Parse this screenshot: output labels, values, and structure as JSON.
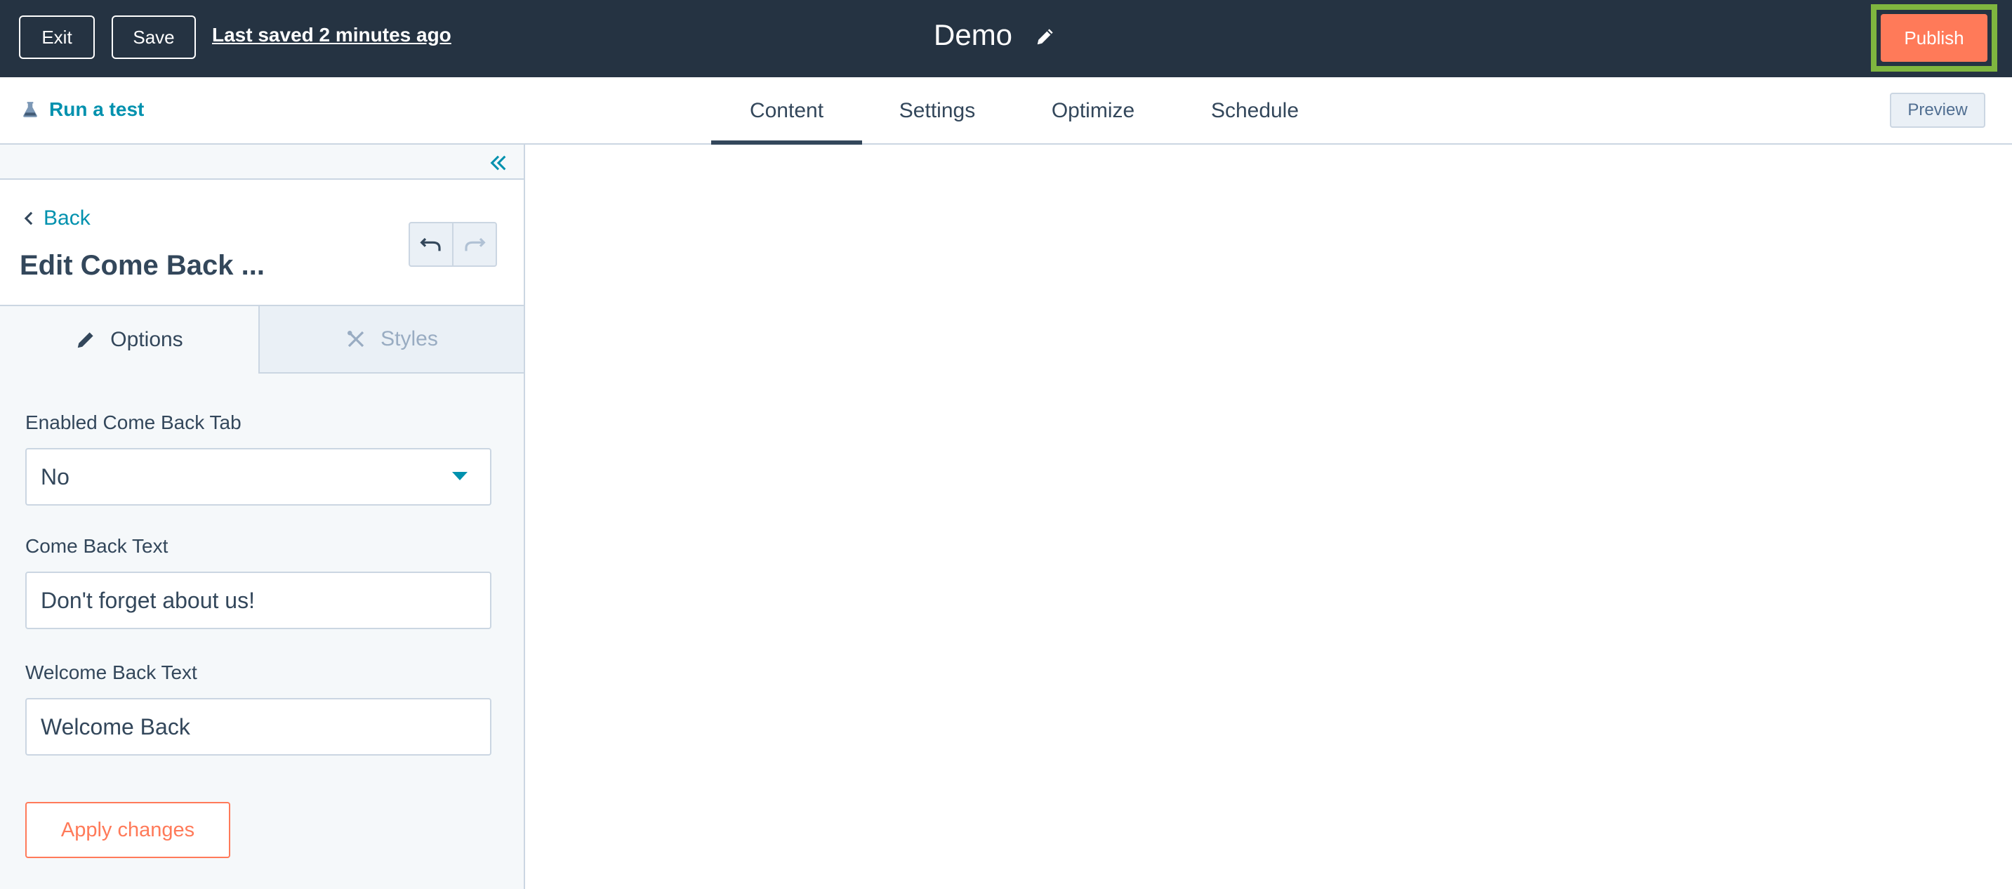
{
  "topbar": {
    "exit_label": "Exit",
    "save_label": "Save",
    "last_saved": "Last saved 2 minutes ago",
    "page_title": "Demo",
    "publish_label": "Publish",
    "publish_highlight_color": "#7fb63f",
    "publish_color": "#ff7a59"
  },
  "subnav": {
    "run_test_label": "Run a test",
    "tabs": [
      {
        "label": "Content",
        "active": true
      },
      {
        "label": "Settings",
        "active": false
      },
      {
        "label": "Optimize",
        "active": false
      },
      {
        "label": "Schedule",
        "active": false
      }
    ],
    "preview_label": "Preview"
  },
  "sidebar": {
    "back_label": "Back",
    "title": "Edit Come Back ...",
    "tabs": [
      {
        "label": "Options",
        "icon": "pencil-icon",
        "active": true
      },
      {
        "label": "Styles",
        "icon": "tools-icon",
        "active": false
      }
    ],
    "fields": [
      {
        "label": "Enabled Come Back Tab",
        "value": "No",
        "type": "select"
      },
      {
        "label": "Come Back Text",
        "value": "Don't forget about us!",
        "type": "text"
      },
      {
        "label": "Welcome Back Text",
        "value": "Welcome Back",
        "type": "text"
      }
    ],
    "apply_label": "Apply changes"
  },
  "colors": {
    "topbar_bg": "#253342",
    "accent": "#0091ae",
    "sidebar_bg": "#f5f8fa"
  }
}
